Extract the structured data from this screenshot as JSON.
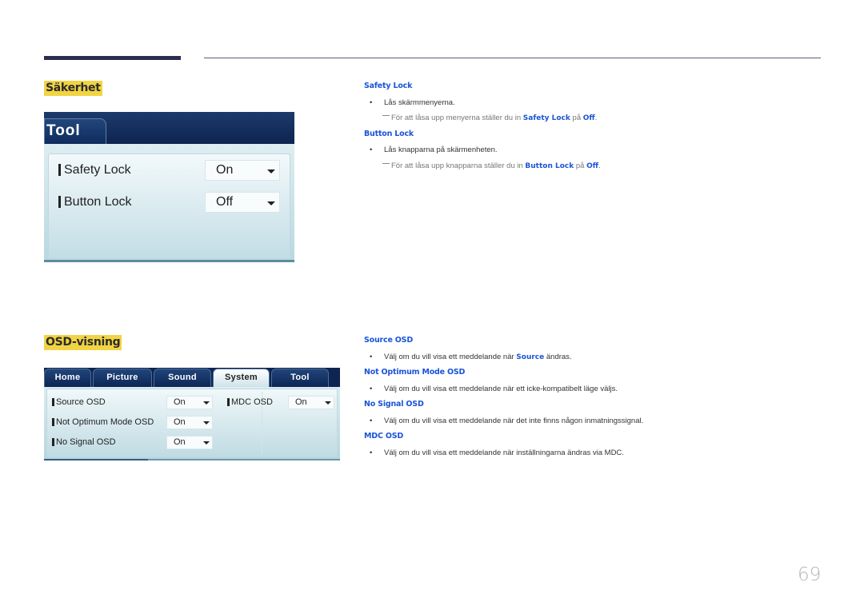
{
  "page_number": "69",
  "sections": {
    "security": {
      "title": "Säkerhet",
      "panel": {
        "tab": "Tool",
        "rows": [
          {
            "label": "Safety Lock",
            "value": "On"
          },
          {
            "label": "Button Lock",
            "value": "Off"
          }
        ]
      },
      "items": [
        {
          "heading": "Safety Lock",
          "bullet": "Lås skärmmenyerna.",
          "note": {
            "pre": "För att låsa upp menyerna ställer du in ",
            "b1": "Safety Lock",
            "mid": " på ",
            "b2": "Off",
            "post": "."
          }
        },
        {
          "heading": "Button Lock",
          "bullet": "Lås knapparna på skärmenheten.",
          "note": {
            "pre": "För att låsa upp knapparna ställer du in ",
            "b1": "Button Lock",
            "mid": " på ",
            "b2": "Off",
            "post": "."
          }
        }
      ]
    },
    "osd": {
      "title": "OSD-visning",
      "panel": {
        "tabs": [
          "Home",
          "Picture",
          "Sound",
          "System",
          "Tool"
        ],
        "active_tab": "System",
        "rows": [
          {
            "label": "Source OSD",
            "value": "On"
          },
          {
            "label": "Not Optimum Mode OSD",
            "value": "On"
          },
          {
            "label": "No Signal OSD",
            "value": "On"
          },
          {
            "label": "MDC OSD",
            "value": "On"
          }
        ]
      },
      "items": [
        {
          "heading": "Source OSD",
          "bullet_pre": "Välj om du vill visa ett meddelande när ",
          "bullet_b": "Source",
          "bullet_post": " ändras."
        },
        {
          "heading": "Not Optimum Mode OSD",
          "bullet": "Välj om du vill visa ett meddelande när ett icke-kompatibelt läge väljs."
        },
        {
          "heading": "No Signal OSD",
          "bullet": "Välj om du vill visa ett meddelande när det inte finns någon inmatningssignal."
        },
        {
          "heading": "MDC OSD",
          "bullet": "Välj om du vill visa ett meddelande när inställningarna ändras via MDC."
        }
      ]
    }
  },
  "bullet_char": "•"
}
